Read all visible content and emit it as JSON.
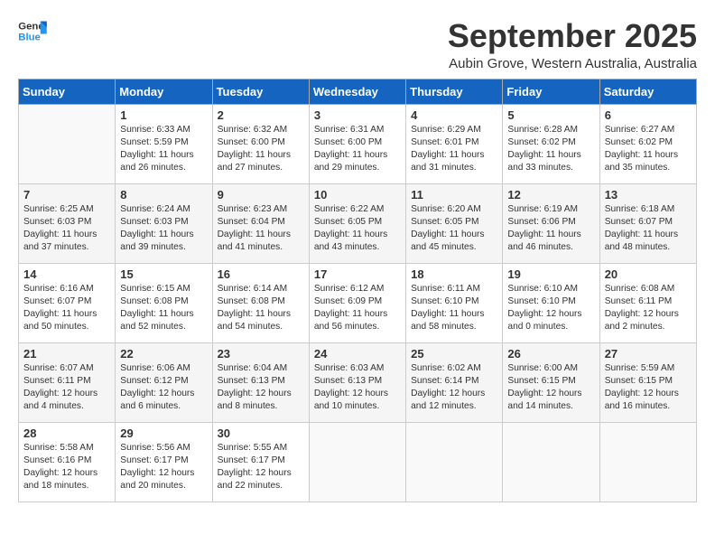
{
  "logo": {
    "general": "General",
    "blue": "Blue"
  },
  "title": "September 2025",
  "location": "Aubin Grove, Western Australia, Australia",
  "days_of_week": [
    "Sunday",
    "Monday",
    "Tuesday",
    "Wednesday",
    "Thursday",
    "Friday",
    "Saturday"
  ],
  "weeks": [
    [
      {
        "day": "",
        "content": ""
      },
      {
        "day": "1",
        "content": "Sunrise: 6:33 AM\nSunset: 5:59 PM\nDaylight: 11 hours\nand 26 minutes."
      },
      {
        "day": "2",
        "content": "Sunrise: 6:32 AM\nSunset: 6:00 PM\nDaylight: 11 hours\nand 27 minutes."
      },
      {
        "day": "3",
        "content": "Sunrise: 6:31 AM\nSunset: 6:00 PM\nDaylight: 11 hours\nand 29 minutes."
      },
      {
        "day": "4",
        "content": "Sunrise: 6:29 AM\nSunset: 6:01 PM\nDaylight: 11 hours\nand 31 minutes."
      },
      {
        "day": "5",
        "content": "Sunrise: 6:28 AM\nSunset: 6:02 PM\nDaylight: 11 hours\nand 33 minutes."
      },
      {
        "day": "6",
        "content": "Sunrise: 6:27 AM\nSunset: 6:02 PM\nDaylight: 11 hours\nand 35 minutes."
      }
    ],
    [
      {
        "day": "7",
        "content": "Sunrise: 6:25 AM\nSunset: 6:03 PM\nDaylight: 11 hours\nand 37 minutes."
      },
      {
        "day": "8",
        "content": "Sunrise: 6:24 AM\nSunset: 6:03 PM\nDaylight: 11 hours\nand 39 minutes."
      },
      {
        "day": "9",
        "content": "Sunrise: 6:23 AM\nSunset: 6:04 PM\nDaylight: 11 hours\nand 41 minutes."
      },
      {
        "day": "10",
        "content": "Sunrise: 6:22 AM\nSunset: 6:05 PM\nDaylight: 11 hours\nand 43 minutes."
      },
      {
        "day": "11",
        "content": "Sunrise: 6:20 AM\nSunset: 6:05 PM\nDaylight: 11 hours\nand 45 minutes."
      },
      {
        "day": "12",
        "content": "Sunrise: 6:19 AM\nSunset: 6:06 PM\nDaylight: 11 hours\nand 46 minutes."
      },
      {
        "day": "13",
        "content": "Sunrise: 6:18 AM\nSunset: 6:07 PM\nDaylight: 11 hours\nand 48 minutes."
      }
    ],
    [
      {
        "day": "14",
        "content": "Sunrise: 6:16 AM\nSunset: 6:07 PM\nDaylight: 11 hours\nand 50 minutes."
      },
      {
        "day": "15",
        "content": "Sunrise: 6:15 AM\nSunset: 6:08 PM\nDaylight: 11 hours\nand 52 minutes."
      },
      {
        "day": "16",
        "content": "Sunrise: 6:14 AM\nSunset: 6:08 PM\nDaylight: 11 hours\nand 54 minutes."
      },
      {
        "day": "17",
        "content": "Sunrise: 6:12 AM\nSunset: 6:09 PM\nDaylight: 11 hours\nand 56 minutes."
      },
      {
        "day": "18",
        "content": "Sunrise: 6:11 AM\nSunset: 6:10 PM\nDaylight: 11 hours\nand 58 minutes."
      },
      {
        "day": "19",
        "content": "Sunrise: 6:10 AM\nSunset: 6:10 PM\nDaylight: 12 hours\nand 0 minutes."
      },
      {
        "day": "20",
        "content": "Sunrise: 6:08 AM\nSunset: 6:11 PM\nDaylight: 12 hours\nand 2 minutes."
      }
    ],
    [
      {
        "day": "21",
        "content": "Sunrise: 6:07 AM\nSunset: 6:11 PM\nDaylight: 12 hours\nand 4 minutes."
      },
      {
        "day": "22",
        "content": "Sunrise: 6:06 AM\nSunset: 6:12 PM\nDaylight: 12 hours\nand 6 minutes."
      },
      {
        "day": "23",
        "content": "Sunrise: 6:04 AM\nSunset: 6:13 PM\nDaylight: 12 hours\nand 8 minutes."
      },
      {
        "day": "24",
        "content": "Sunrise: 6:03 AM\nSunset: 6:13 PM\nDaylight: 12 hours\nand 10 minutes."
      },
      {
        "day": "25",
        "content": "Sunrise: 6:02 AM\nSunset: 6:14 PM\nDaylight: 12 hours\nand 12 minutes."
      },
      {
        "day": "26",
        "content": "Sunrise: 6:00 AM\nSunset: 6:15 PM\nDaylight: 12 hours\nand 14 minutes."
      },
      {
        "day": "27",
        "content": "Sunrise: 5:59 AM\nSunset: 6:15 PM\nDaylight: 12 hours\nand 16 minutes."
      }
    ],
    [
      {
        "day": "28",
        "content": "Sunrise: 5:58 AM\nSunset: 6:16 PM\nDaylight: 12 hours\nand 18 minutes."
      },
      {
        "day": "29",
        "content": "Sunrise: 5:56 AM\nSunset: 6:17 PM\nDaylight: 12 hours\nand 20 minutes."
      },
      {
        "day": "30",
        "content": "Sunrise: 5:55 AM\nSunset: 6:17 PM\nDaylight: 12 hours\nand 22 minutes."
      },
      {
        "day": "",
        "content": ""
      },
      {
        "day": "",
        "content": ""
      },
      {
        "day": "",
        "content": ""
      },
      {
        "day": "",
        "content": ""
      }
    ]
  ]
}
